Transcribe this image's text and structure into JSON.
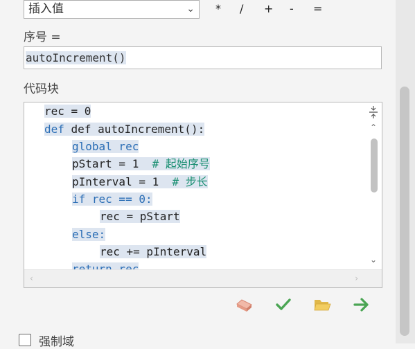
{
  "toolbar": {
    "expression_type": "插入值",
    "operators": [
      "*",
      "/",
      "+",
      "-",
      "="
    ]
  },
  "field": {
    "label": "序号 =",
    "value": "autoIncrement()"
  },
  "code_block": {
    "label": "代码块",
    "lines": [
      "rec = 0",
      "def autoIncrement():",
      "global rec",
      "pStart = 1",
      "# 起始序号",
      "pInterval = 1",
      "# 步长",
      "if rec == 0:",
      "rec = pStart",
      "else:",
      "rec += pInterval",
      "return rec"
    ]
  },
  "actions": {
    "icons": [
      "eraser-icon",
      "checkmark-icon",
      "open-folder-icon",
      "arrow-right-icon"
    ]
  },
  "options": {
    "checkbox_label": "强制域"
  },
  "colors": {
    "keyword": "#2a6db5",
    "comment": "#1a8f72",
    "selection": "#dde5f0"
  }
}
